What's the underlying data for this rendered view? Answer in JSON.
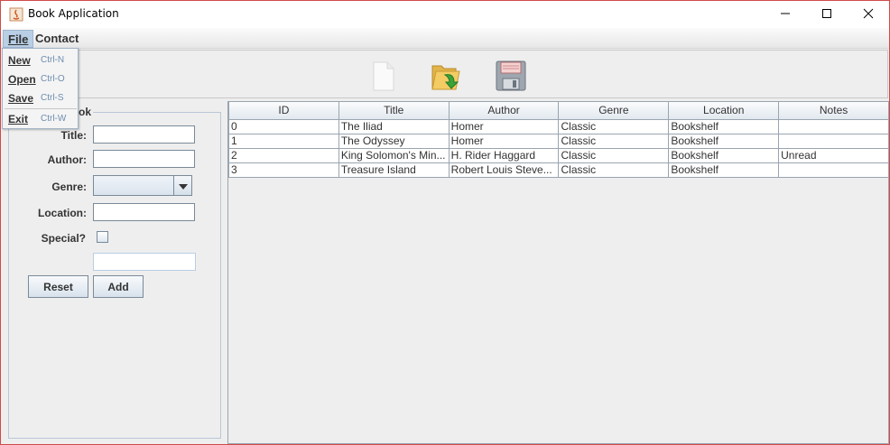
{
  "window": {
    "title": "Book Application",
    "accent_border": "#d04a4a"
  },
  "titlebar_buttons": [
    "minimize-icon",
    "maximize-icon",
    "close-icon"
  ],
  "menubar": {
    "file_label": "File",
    "contact_label": "Contact"
  },
  "file_menu": {
    "items": [
      {
        "label": "New",
        "accelerator": "Ctrl-N"
      },
      {
        "label": "Open",
        "accelerator": "Ctrl-O"
      },
      {
        "label": "Save",
        "accelerator": "Ctrl-S"
      },
      {
        "label": "Exit",
        "accelerator": "Ctrl-W"
      }
    ]
  },
  "toolbar": {
    "icons": [
      "new-document-icon",
      "open-folder-icon",
      "save-disk-icon"
    ]
  },
  "form": {
    "legend": "ok",
    "title_label": "Title:",
    "author_label": "Author:",
    "genre_label": "Genre:",
    "location_label": "Location:",
    "special_label": "Special?",
    "title_value": "",
    "author_value": "",
    "genre_value": "",
    "location_value": "",
    "special_value": "",
    "special_checked": false,
    "reset_label": "Reset",
    "add_label": "Add"
  },
  "table": {
    "columns": [
      "ID",
      "Title",
      "Author",
      "Genre",
      "Location",
      "Notes"
    ],
    "rows": [
      [
        "0",
        "The Iliad",
        "Homer",
        "Classic",
        "Bookshelf",
        ""
      ],
      [
        "1",
        "The Odyssey",
        "Homer",
        "Classic",
        "Bookshelf",
        ""
      ],
      [
        "2",
        "King Solomon's Min...",
        "H. Rider Haggard",
        "Classic",
        "Bookshelf",
        "Unread"
      ],
      [
        "3",
        "Treasure Island",
        "Robert Louis Steve...",
        "Classic",
        "Bookshelf",
        ""
      ]
    ]
  }
}
